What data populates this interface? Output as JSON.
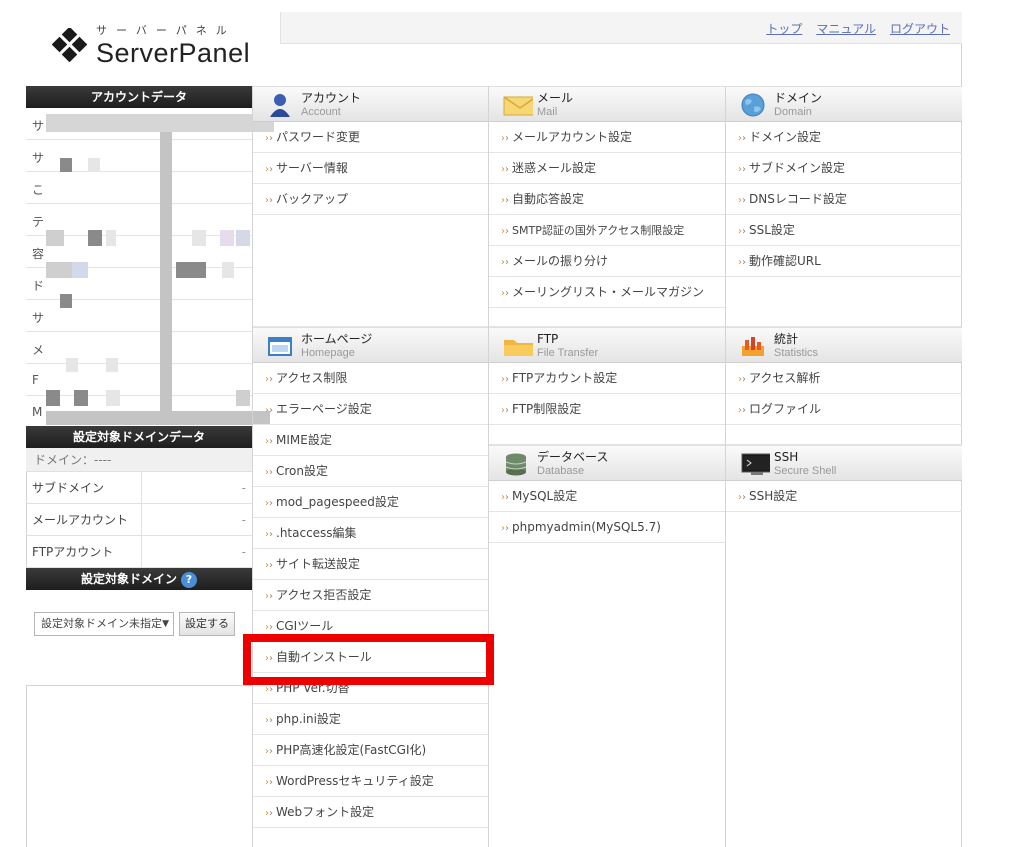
{
  "header": {
    "logo_kana": "サーバーパネル",
    "logo_text": "ServerPanel",
    "links": [
      "トップ",
      "マニュアル",
      "ログアウト"
    ]
  },
  "sidebar": {
    "account_title": "アカウントデータ",
    "account_rows": [
      "サ",
      "サ",
      "こ",
      "テ",
      "容",
      "ド",
      "サ",
      "メ",
      "F",
      "M"
    ],
    "domain_title": "設定対象ドメインデータ",
    "domain_label": "ドメイン：----",
    "domain_rows": [
      {
        "k": "サブドメイン",
        "v": "-"
      },
      {
        "k": "メールアカウント",
        "v": "-"
      },
      {
        "k": "FTPアカウント",
        "v": "-"
      }
    ],
    "select_title": "設定対象ドメイン",
    "help": "?",
    "select_value": "設定対象ドメイン未指定",
    "select_button": "設定する"
  },
  "sections": {
    "account": {
      "title": "アカウント",
      "sub": "Account",
      "items": [
        "パスワード変更",
        "サーバー情報",
        "バックアップ"
      ]
    },
    "mail": {
      "title": "メール",
      "sub": "Mail",
      "items": [
        "メールアカウント設定",
        "迷惑メール設定",
        "自動応答設定",
        "SMTP認証の国外アクセス制限設定",
        "メールの振り分け",
        "メーリングリスト・メールマガジン"
      ]
    },
    "domain": {
      "title": "ドメイン",
      "sub": "Domain",
      "items": [
        "ドメイン設定",
        "サブドメイン設定",
        "DNSレコード設定",
        "SSL設定",
        "動作確認URL"
      ]
    },
    "homepage": {
      "title": "ホームページ",
      "sub": "Homepage",
      "items": [
        "アクセス制限",
        "エラーページ設定",
        "MIME設定",
        "Cron設定",
        "mod_pagespeed設定",
        ".htaccess編集",
        "サイト転送設定",
        "アクセス拒否設定",
        "CGIツール",
        "自動インストール",
        "PHP Ver.切替",
        "php.ini設定",
        "PHP高速化設定(FastCGI化)",
        "WordPressセキュリティ設定",
        "Webフォント設定"
      ]
    },
    "ftp": {
      "title": "FTP",
      "sub": "File Transfer",
      "items": [
        "FTPアカウント設定",
        "FTP制限設定"
      ]
    },
    "stats": {
      "title": "統計",
      "sub": "Statistics",
      "items": [
        "アクセス解析",
        "ログファイル"
      ]
    },
    "database": {
      "title": "データベース",
      "sub": "Database",
      "items": [
        "MySQL設定",
        "phpmyadmin(MySQL5.7)"
      ]
    },
    "ssh": {
      "title": "SSH",
      "sub": "Secure Shell",
      "items": [
        "SSH設定"
      ]
    }
  },
  "colors": {
    "highlight": "#ee0000",
    "link": "#5a6fb8",
    "sidebar_head": "#2a2a2a"
  }
}
